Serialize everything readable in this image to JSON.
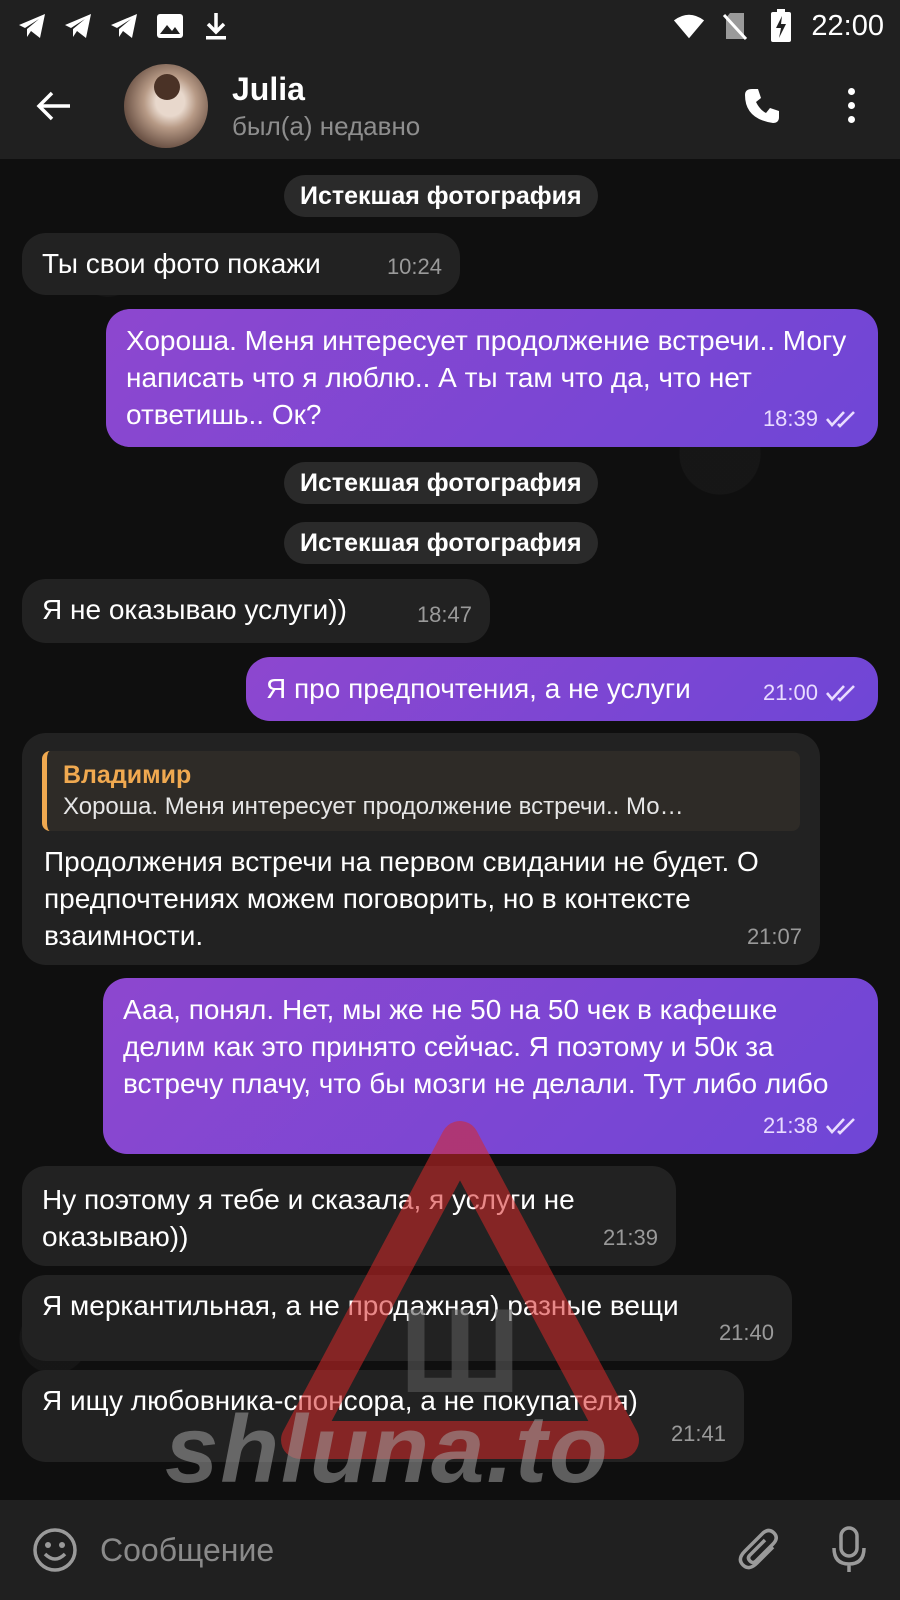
{
  "status_bar": {
    "time": "22:00",
    "left_icons": [
      "telegram-icon",
      "telegram-icon",
      "telegram-icon",
      "image-icon",
      "download-icon"
    ],
    "right_icons": [
      "wifi-icon",
      "no-sim-icon",
      "battery-charging-icon"
    ]
  },
  "header": {
    "name": "Julia",
    "status": "был(а) недавно"
  },
  "system": {
    "expired_photo": "Истекшая фотография"
  },
  "messages": [
    {
      "direction": "in",
      "text": "Ты свои фото покажи",
      "time": "10:24"
    },
    {
      "direction": "out",
      "text": "Хороша. Меня интересует продолжение встречи.. Могу написать что я люблю.. А ты там что да, что нет ответишь.. Ок?",
      "time": "18:39",
      "read": true
    },
    {
      "direction": "in",
      "text": "Я не оказываю услуги))",
      "time": "18:47"
    },
    {
      "direction": "out",
      "text": "Я про предпочтения, а не услуги",
      "time": "21:00",
      "read": true
    },
    {
      "direction": "in",
      "reply_to": {
        "name": "Владимир",
        "text": "Хороша. Меня интересует продолжение встречи.. Мо…"
      },
      "text": "Продолжения встречи на первом свидании не будет. О предпочтениях можем поговорить, но в контексте взаимности.",
      "time": "21:07"
    },
    {
      "direction": "out",
      "text": "Ааа, понял. Нет, мы же не 50 на 50 чек в кафешке делим как это принято сейчас. Я поэтому и 50к за встречу плачу, что бы мозги не делали. Тут либо либо",
      "time": "21:38",
      "read": true
    },
    {
      "direction": "in",
      "text": "Ну поэтому я тебе и сказала, я услуги не оказываю))",
      "time": "21:39"
    },
    {
      "direction": "in",
      "text": "Я меркантильная, а не продажная) разные вещи",
      "time": "21:40"
    },
    {
      "direction": "in",
      "text": "Я ищу любовника-спонсора, а не покупателя)",
      "time": "21:41"
    }
  ],
  "watermark": {
    "text": "shluna.to",
    "logo_letter": "Ш"
  },
  "composer": {
    "placeholder": "Сообщение"
  },
  "colors": {
    "bar": "#202020",
    "incoming": "#222222",
    "outgoing_start": "#8d47cf",
    "outgoing_end": "#6f46d6",
    "reply_accent": "#f0a950"
  }
}
